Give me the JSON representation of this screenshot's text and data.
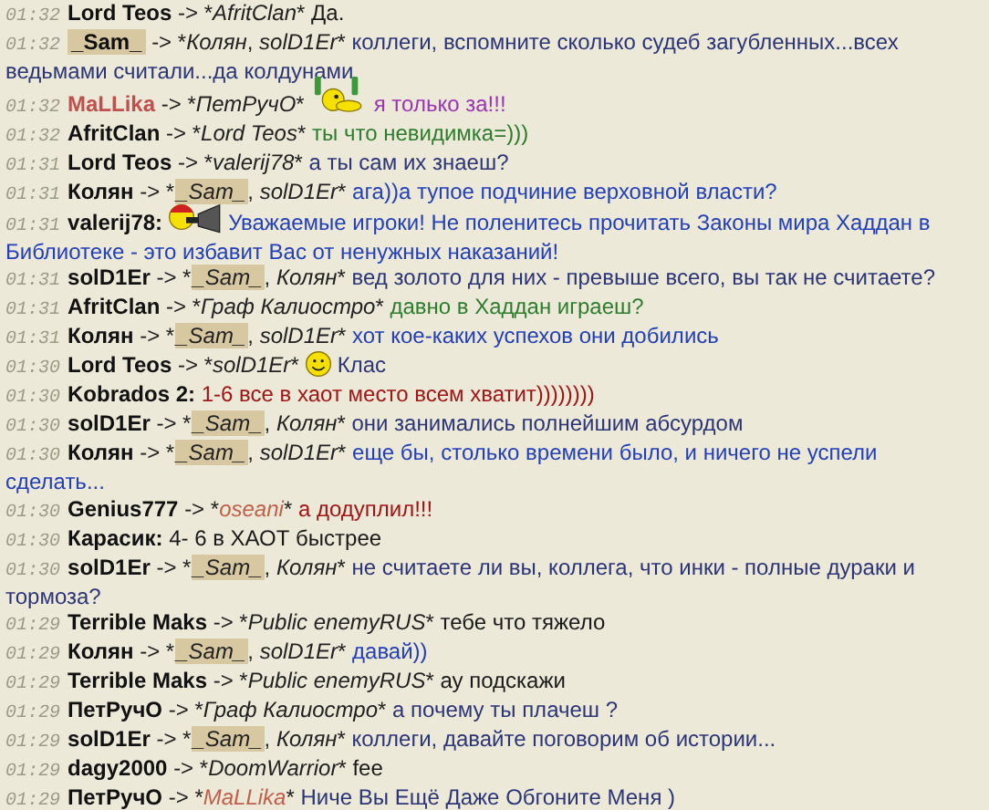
{
  "messages": [
    {
      "time": "01:32",
      "sender": {
        "name": "Lord Teos",
        "highlighted": false
      },
      "arrow": "-> *",
      "recipients": [
        {
          "name": "AfritClan",
          "after": "*",
          "highlighted": false
        }
      ],
      "text": "Да.",
      "color": "#1a1a1a"
    },
    {
      "time": "01:32",
      "sender": {
        "name": "_Sam_",
        "highlighted": true
      },
      "arrow": "-> *",
      "recipients": [
        {
          "name": "Колян",
          "after": ", ",
          "highlighted": false
        },
        {
          "name": "solD1Er",
          "after": "*",
          "highlighted": false
        }
      ],
      "text": "коллеги, вспомните сколько судеб загубленных...всех ведьмами считали...да колдунами",
      "color": "#2b3577"
    },
    {
      "time": "01:32",
      "sender": {
        "name": "MaLLika",
        "highlighted": false,
        "color": "#c0504d"
      },
      "arrow": "-> *",
      "recipients": [
        {
          "name": "ПетРучО",
          "after": "*",
          "highlighted": false
        }
      ],
      "emoticon": {
        "kind": "beer"
      },
      "text": "я только за!!!",
      "color": "#9a35b5"
    },
    {
      "time": "01:32",
      "sender": {
        "name": "AfritClan",
        "highlighted": false
      },
      "arrow": "-> *",
      "recipients": [
        {
          "name": "Lord Teos",
          "after": "*",
          "highlighted": false
        }
      ],
      "text": "ты что невидимка=)))",
      "color": "#2e7d2e"
    },
    {
      "time": "01:31",
      "sender": {
        "name": "Lord Teos",
        "highlighted": false
      },
      "arrow": "-> *",
      "recipients": [
        {
          "name": "valerij78",
          "after": "*",
          "highlighted": false
        }
      ],
      "text": "а ты сам их знаеш?",
      "color": "#2b3577"
    },
    {
      "time": "01:31",
      "sender": {
        "name": "Колян",
        "highlighted": false
      },
      "arrow": "-> *",
      "recipients": [
        {
          "name": "_Sam_",
          "after": ", ",
          "highlighted": true
        },
        {
          "name": "solD1Er",
          "after": "*",
          "highlighted": false
        }
      ],
      "text": "ага))а тупое подчиние верховной власти?",
      "color": "#2340b8"
    },
    {
      "time": "01:31",
      "sender": {
        "name": "valerij78:",
        "highlighted": false
      },
      "emoticon": {
        "kind": "megaphone"
      },
      "text": "Уважаемые игроки! Не поленитесь прочитать Законы мира Хаддан в Библиотеке - это избавит Вас от ненужных наказаний!",
      "color": "#2340b8"
    },
    {
      "time": "01:31",
      "sender": {
        "name": "solD1Er",
        "highlighted": false
      },
      "arrow": "-> *",
      "recipients": [
        {
          "name": "_Sam_",
          "after": ", ",
          "highlighted": true
        },
        {
          "name": "Колян",
          "after": "*",
          "highlighted": false
        }
      ],
      "text": "вед золото для них - превыше всего, вы так не считаете?",
      "color": "#2b3577"
    },
    {
      "time": "01:31",
      "sender": {
        "name": "AfritClan",
        "highlighted": false
      },
      "arrow": "-> *",
      "recipients": [
        {
          "name": "Граф Калиостро",
          "after": "*",
          "highlighted": false
        }
      ],
      "text": "давно в Хаддан играеш?",
      "color": "#2e7d2e"
    },
    {
      "time": "01:31",
      "sender": {
        "name": "Колян",
        "highlighted": false
      },
      "arrow": "-> *",
      "recipients": [
        {
          "name": "_Sam_",
          "after": ", ",
          "highlighted": true
        },
        {
          "name": "solD1Er",
          "after": "*",
          "highlighted": false
        }
      ],
      "text": "хот кое-каких успехов они добились",
      "color": "#2340b8"
    },
    {
      "time": "01:30",
      "sender": {
        "name": "Lord Teos",
        "highlighted": false
      },
      "arrow": "-> *",
      "recipients": [
        {
          "name": "solD1Er",
          "after": "*",
          "highlighted": false
        }
      ],
      "text": "Клас",
      "color": "#2b3577",
      "emoticon": {
        "kind": "smile"
      }
    },
    {
      "time": "01:30",
      "sender": {
        "name": "Kobrados 2:",
        "highlighted": false
      },
      "text": "1-6 все в хаот место всем хватит))))))))",
      "color": "#a01515"
    },
    {
      "time": "01:30",
      "sender": {
        "name": "solD1Er",
        "highlighted": false
      },
      "arrow": "-> *",
      "recipients": [
        {
          "name": "_Sam_",
          "after": ", ",
          "highlighted": true
        },
        {
          "name": "Колян",
          "after": "*",
          "highlighted": false
        }
      ],
      "text": "они занимались полнейшим абсурдом",
      "color": "#2b3577"
    },
    {
      "time": "01:30",
      "sender": {
        "name": "Колян",
        "highlighted": false
      },
      "arrow": "-> *",
      "recipients": [
        {
          "name": "_Sam_",
          "after": ", ",
          "highlighted": true
        },
        {
          "name": "solD1Er",
          "after": "*",
          "highlighted": false
        }
      ],
      "text": "еще бы, столько времени было, и ничего не успели сделать...",
      "color": "#2340b8"
    },
    {
      "time": "01:30",
      "sender": {
        "name": "Genius777",
        "highlighted": false
      },
      "arrow": "-> *",
      "recipients": [
        {
          "name": "oseani",
          "after": "*",
          "highlighted": false,
          "color": "#c0604a"
        }
      ],
      "text": "а додуплил!!!",
      "color": "#a01515"
    },
    {
      "time": "01:30",
      "sender": {
        "name": "Карасик:",
        "highlighted": false
      },
      "text": "4- 6 в ХАОТ быстрее",
      "color": "#1a1a1a"
    },
    {
      "time": "01:30",
      "sender": {
        "name": "solD1Er",
        "highlighted": false
      },
      "arrow": "-> *",
      "recipients": [
        {
          "name": "_Sam_",
          "after": ", ",
          "highlighted": true
        },
        {
          "name": "Колян",
          "after": "*",
          "highlighted": false
        }
      ],
      "text": "не считаете ли вы, коллега, что инки - полные дураки и тормоза?",
      "color": "#2b3577"
    },
    {
      "time": "01:29",
      "sender": {
        "name": "Terrible Maks",
        "highlighted": false
      },
      "arrow": "-> *",
      "recipients": [
        {
          "name": "Public enemyRUS",
          "after": "*",
          "highlighted": false
        }
      ],
      "text": "тебе что тяжело",
      "color": "#1a1a1a"
    },
    {
      "time": "01:29",
      "sender": {
        "name": "Колян",
        "highlighted": false
      },
      "arrow": "-> *",
      "recipients": [
        {
          "name": "_Sam_",
          "after": ", ",
          "highlighted": true
        },
        {
          "name": "solD1Er",
          "after": "*",
          "highlighted": false
        }
      ],
      "text": "давай))",
      "color": "#2340b8"
    },
    {
      "time": "01:29",
      "sender": {
        "name": "Terrible Maks",
        "highlighted": false
      },
      "arrow": "-> *",
      "recipients": [
        {
          "name": "Public enemyRUS",
          "after": "*",
          "highlighted": false
        }
      ],
      "text": "ау подскажи",
      "color": "#1a1a1a"
    },
    {
      "time": "01:29",
      "sender": {
        "name": "ПетРучО",
        "highlighted": false
      },
      "arrow": "-> *",
      "recipients": [
        {
          "name": "Граф Калиостро",
          "after": "*",
          "highlighted": false
        }
      ],
      "text": "а почему ты плачеш ?",
      "color": "#2b3577"
    },
    {
      "time": "01:29",
      "sender": {
        "name": "solD1Er",
        "highlighted": false
      },
      "arrow": "-> *",
      "recipients": [
        {
          "name": "_Sam_",
          "after": ", ",
          "highlighted": true
        },
        {
          "name": "Колян",
          "after": "*",
          "highlighted": false
        }
      ],
      "text": "коллеги, давайте поговорим об истории...",
      "color": "#2b3577"
    },
    {
      "time": "01:29",
      "sender": {
        "name": "dagy2000",
        "highlighted": false
      },
      "arrow": "-> *",
      "recipients": [
        {
          "name": "DoomWarrior",
          "after": "*",
          "highlighted": false
        }
      ],
      "text": "fee",
      "color": "#1a1a1a"
    },
    {
      "time": "01:29",
      "sender": {
        "name": "ПетРучО",
        "highlighted": false
      },
      "arrow": "-> *",
      "recipients": [
        {
          "name": "MaLLika",
          "after": "*",
          "highlighted": false,
          "color": "#c0604a"
        }
      ],
      "text": "Ниче Вы Ещё Даже Обгоните Меня )",
      "color": "#2b3577"
    }
  ]
}
